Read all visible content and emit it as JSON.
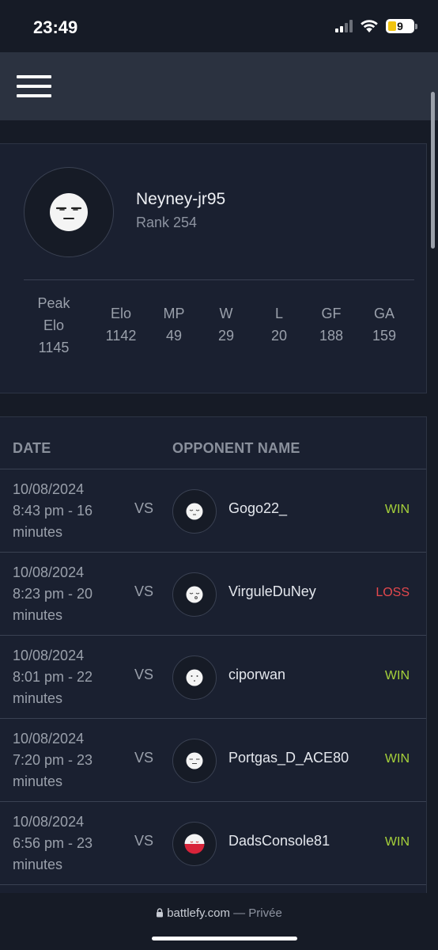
{
  "status_bar": {
    "time": "23:49",
    "battery_level": "9"
  },
  "header": {
    "menu_icon": "hamburger-menu-icon"
  },
  "profile": {
    "player_name": "Neyney-jr95",
    "rank": "Rank 254",
    "stats": {
      "peak_elo_label": "Peak Elo",
      "peak_elo_value": "1145",
      "elo_label": "Elo",
      "elo_value": "1142",
      "mp_label": "MP",
      "mp_value": "49",
      "w_label": "W",
      "w_value": "29",
      "l_label": "L",
      "l_value": "20",
      "gf_label": "GF",
      "gf_value": "188",
      "ga_label": "GA",
      "ga_value": "159"
    }
  },
  "matches": {
    "date_header": "DATE",
    "opponent_header": "OPPONENT NAME",
    "vs_label": "VS",
    "rows": [
      {
        "date": "10/08/2024",
        "time": "8:43 pm - 16",
        "duration_unit": "minutes",
        "opponent": "Gogo22_",
        "result": "WIN"
      },
      {
        "date": "10/08/2024",
        "time": "8:23 pm - 20",
        "duration_unit": "minutes",
        "opponent": "VirguleDuNey",
        "result": "LOSS"
      },
      {
        "date": "10/08/2024",
        "time": "8:01 pm - 22",
        "duration_unit": "minutes",
        "opponent": "ciporwan",
        "result": "WIN"
      },
      {
        "date": "10/08/2024",
        "time": "7:20 pm - 23",
        "duration_unit": "minutes",
        "opponent": "Portgas_D_ACE80",
        "result": "WIN"
      },
      {
        "date": "10/08/2024",
        "time": "6:56 pm - 23",
        "duration_unit": "minutes",
        "opponent": "DadsConsole81",
        "result": "WIN"
      }
    ]
  },
  "browser": {
    "domain": "battlefy.com",
    "mode": "— Privée"
  },
  "colors": {
    "win": "#a6d13a",
    "loss": "#e5484d",
    "background": "#161b26",
    "card": "#1a2030",
    "header": "#2b3240"
  }
}
